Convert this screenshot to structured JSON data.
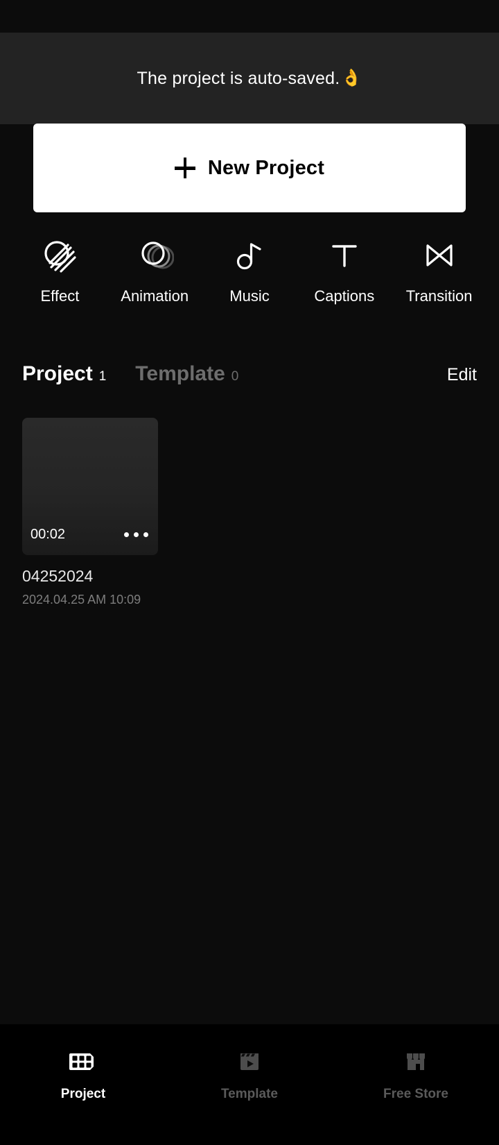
{
  "app": {
    "background": "#0c0c0c",
    "toast_background": "#232323",
    "accent_white": "#ffffff",
    "muted_gray": "#6d6d6d"
  },
  "toast": {
    "message": "The project is auto-saved.",
    "emoji": "👌",
    "emoji_name": "ok-hand-emoji"
  },
  "new_project": {
    "label": "New Project",
    "plus_icon": "plus-icon"
  },
  "tools": [
    {
      "label": "Effect",
      "icon": "effect-icon"
    },
    {
      "label": "Animation",
      "icon": "animation-icon"
    },
    {
      "label": "Music",
      "icon": "music-note-icon"
    },
    {
      "label": "Captions",
      "icon": "text-t-icon"
    },
    {
      "label": "Transition",
      "icon": "transition-bowtie-icon"
    }
  ],
  "tabs": [
    {
      "name": "Project",
      "count": "1",
      "active": true
    },
    {
      "name": "Template",
      "count": "0",
      "active": false
    }
  ],
  "edit": {
    "label": "Edit"
  },
  "projects": [
    {
      "title": "04252024",
      "date": "2024.04.25 AM 10:09",
      "duration": "00:02",
      "menu_icon": "more-options-icon"
    }
  ],
  "bottom_nav": [
    {
      "label": "Project",
      "icon": "film-strip-icon",
      "active": true
    },
    {
      "label": "Template",
      "icon": "clapperboard-icon",
      "active": false
    },
    {
      "label": "Free Store",
      "icon": "storefront-icon",
      "active": false
    }
  ]
}
